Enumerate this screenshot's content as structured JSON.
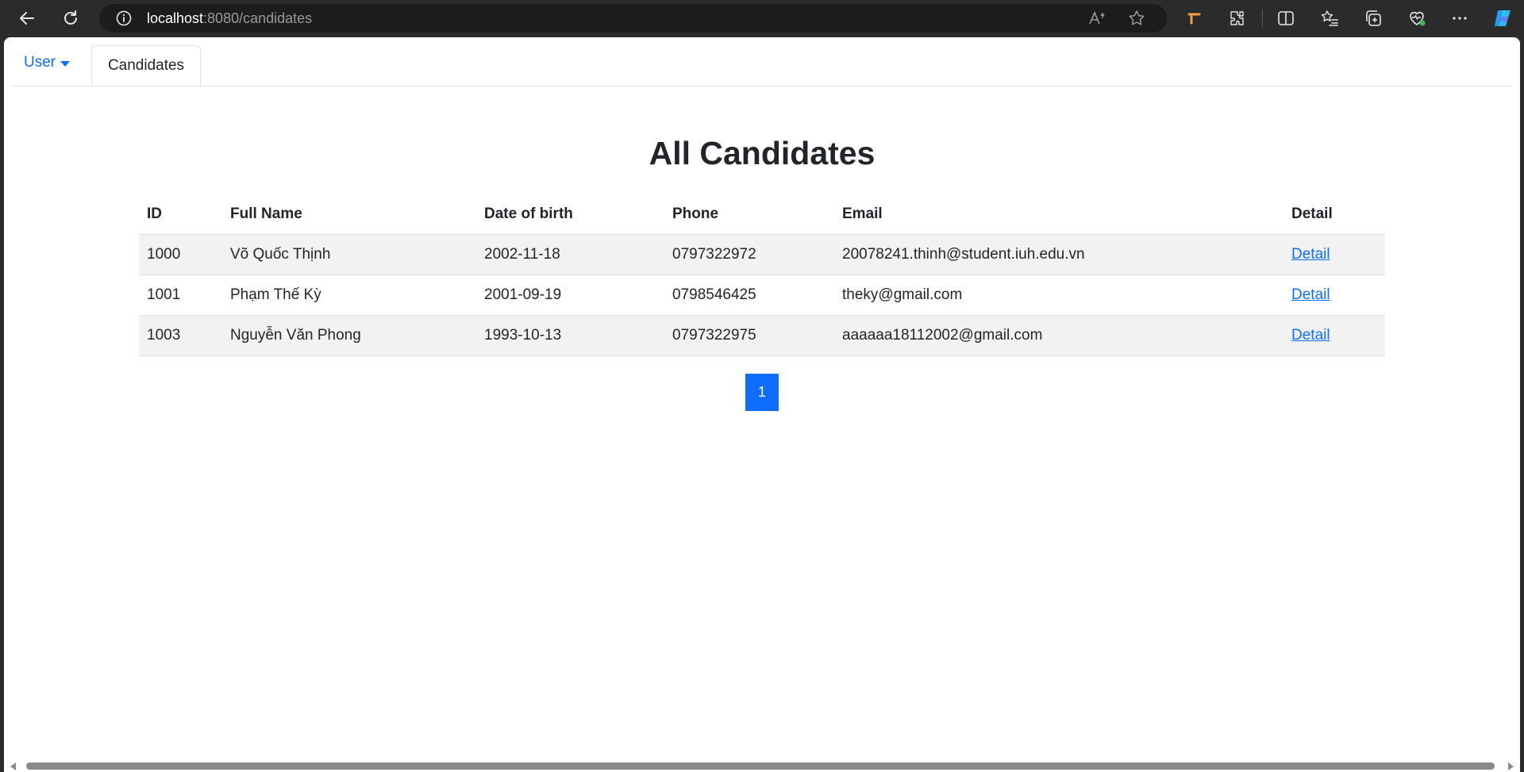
{
  "browser": {
    "url_host": "localhost",
    "url_path": ":8080/candidates"
  },
  "nav": {
    "user_label": "User",
    "candidates_label": "Candidates"
  },
  "page": {
    "title": "All Candidates"
  },
  "table": {
    "headers": [
      "ID",
      "Full Name",
      "Date of birth",
      "Phone",
      "Email",
      "Detail"
    ],
    "rows": [
      {
        "id": "1000",
        "name": "Võ Quốc Thịnh",
        "dob": "2002-11-18",
        "phone": "0797322972",
        "email": "20078241.thinh@student.iuh.edu.vn",
        "detail": "Detail"
      },
      {
        "id": "1001",
        "name": "Phạm Thế Kỳ",
        "dob": "2001-09-19",
        "phone": "0798546425",
        "email": "theky@gmail.com",
        "detail": "Detail"
      },
      {
        "id": "1003",
        "name": "Nguyễn Văn Phong",
        "dob": "1993-10-13",
        "phone": "0797322975",
        "email": "aaaaaa18112002@gmail.com",
        "detail": "Detail"
      }
    ]
  },
  "pagination": {
    "current_page": "1"
  },
  "colors": {
    "accent": "#0d6efd",
    "stripe": "#f2f2f2",
    "chrome": "#2b2b2b"
  }
}
